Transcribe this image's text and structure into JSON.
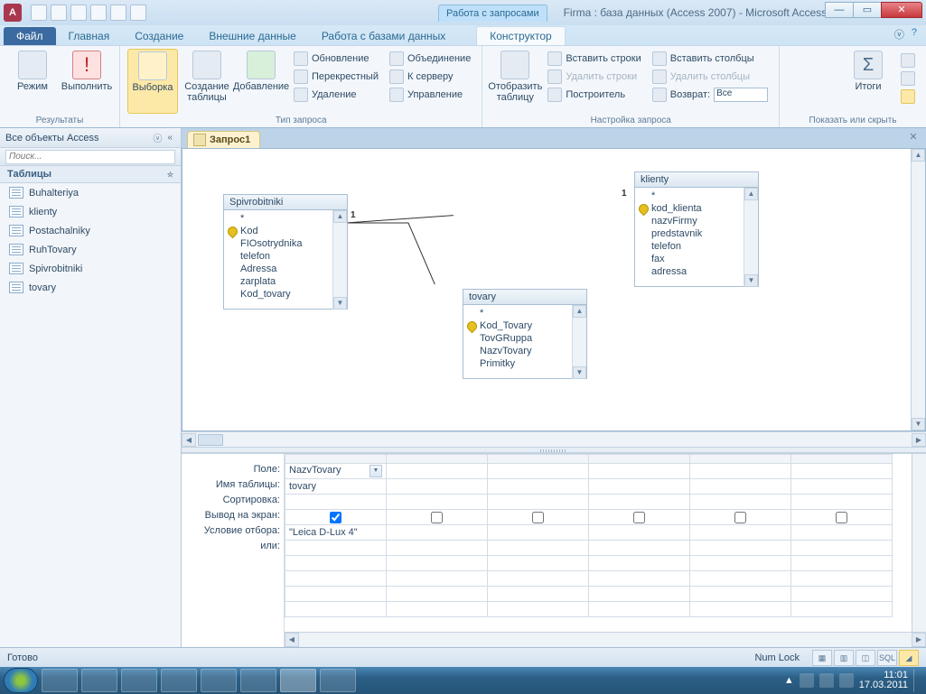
{
  "titlebar": {
    "context_title": "Работа с запросами",
    "window_title": "Firma : база данных (Access 2007)  -  Microsoft Access",
    "app_letter": "A"
  },
  "tabs": {
    "file": "Файл",
    "items": [
      "Главная",
      "Создание",
      "Внешние данные",
      "Работа с базами данных"
    ],
    "context_tab": "Конструктор"
  },
  "ribbon": {
    "grp_results": {
      "label": "Результаты",
      "btn_view": "Режим",
      "btn_run": "Выполнить"
    },
    "grp_qtype": {
      "label": "Тип запроса",
      "btn_select": "Выборка",
      "btn_maketable": "Создание\nтаблицы",
      "btn_append": "Добавление",
      "btn_update": "Обновление",
      "btn_crosstab": "Перекрестный",
      "btn_delete": "Удаление",
      "btn_union": "Объединение",
      "btn_passthrough": "К серверу",
      "btn_datadef": "Управление"
    },
    "grp_setup": {
      "label": "Настройка запроса",
      "btn_showtable": "Отобразить\nтаблицу",
      "btn_insrows": "Вставить строки",
      "btn_delrows": "Удалить строки",
      "btn_builder": "Построитель",
      "btn_inscols": "Вставить столбцы",
      "btn_delcols": "Удалить столбцы",
      "lbl_return": "Возврат:",
      "val_return": "Все"
    },
    "grp_showhide": {
      "label": "Показать или скрыть",
      "btn_totals": "Итоги"
    }
  },
  "navpane": {
    "header": "Все объекты Access",
    "group": "Таблицы",
    "items": [
      "Buhalteriya",
      "klienty",
      "Postachalniky",
      "RuhTovary",
      "Spivrobitniki",
      "tovary"
    ]
  },
  "doc": {
    "tab_name": "Запрос1"
  },
  "tables": {
    "t1": {
      "title": "Spivrobitniki",
      "star": "*",
      "fields": [
        "Kod",
        "FIOsotrydnika",
        "telefon",
        "Adressa",
        "zarplata",
        "Kod_tovary"
      ],
      "keys": [
        "Kod"
      ]
    },
    "t2": {
      "title": "tovary",
      "star": "*",
      "fields": [
        "Kod_Tovary",
        "TovGRuppa",
        "NazvTovary",
        "Primitky"
      ],
      "keys": [
        "Kod_Tovary"
      ]
    },
    "t3": {
      "title": "klienty",
      "star": "*",
      "fields": [
        "kod_klienta",
        "nazvFirmy",
        "predstavnik",
        "telefon",
        "fax",
        "adressa"
      ],
      "keys": [
        "kod_klienta"
      ]
    }
  },
  "rel": {
    "one_a": "1",
    "one_b": "1"
  },
  "qbe": {
    "labels": {
      "field": "Поле:",
      "table": "Имя таблицы:",
      "sort": "Сортировка:",
      "show": "Вывод на экран:",
      "criteria": "Условие отбора:",
      "or": "или:"
    },
    "col1": {
      "field": "NazvTovary",
      "table": "tovary",
      "criteria": "\"Leica D-Lux 4\"",
      "show": true
    }
  },
  "status": {
    "ready": "Готово",
    "numlock": "Num Lock",
    "sql": "SQL"
  },
  "tray": {
    "time": "11:01",
    "date": "17.03.2011"
  }
}
